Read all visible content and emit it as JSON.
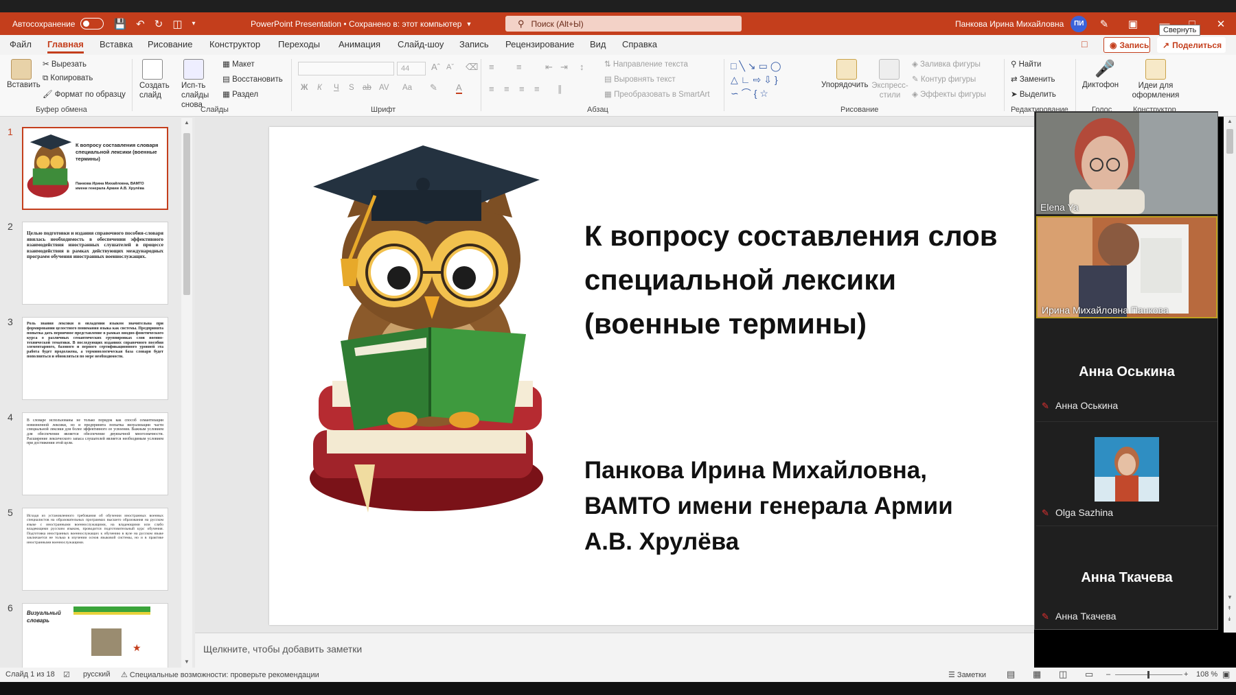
{
  "titlebar": {
    "autosave_label": "Автосохранение",
    "doc_title": "PowerPoint Presentation • Сохранено в: этот компьютер",
    "search_placeholder": "Поиск (Alt+Ы)",
    "user_name": "Панкова Ирина Михайловна",
    "user_initials": "ПИ",
    "tooltip": "Свернуть"
  },
  "tabs": [
    "Файл",
    "Главная",
    "Вставка",
    "Рисование",
    "Конструктор",
    "Переходы",
    "Анимация",
    "Слайд-шоу",
    "Запись",
    "Рецензирование",
    "Вид",
    "Справка"
  ],
  "tab_actions": {
    "record": "Запись",
    "share": "Поделиться"
  },
  "ribbon": {
    "clipboard": {
      "paste": "Вставить",
      "cut": "Вырезать",
      "copy": "Копировать",
      "format_painter": "Формат по образцу",
      "group": "Буфер обмена"
    },
    "slides": {
      "new_slide": "Создать слайд",
      "reuse": "Исп-ть слайды снова",
      "layout": "Макет",
      "reset": "Восстановить",
      "section": "Раздел",
      "group": "Слайды"
    },
    "font": {
      "size": "44",
      "group": "Шрифт"
    },
    "paragraph": {
      "text_direction": "Направление текста",
      "align_text": "Выровнять текст",
      "smartart": "Преобразовать в SmartArt",
      "group": "Абзац"
    },
    "drawing": {
      "arrange": "Упорядочить",
      "quick_styles": "Экспресс-стили",
      "fill": "Заливка фигуры",
      "outline": "Контур фигуры",
      "effects": "Эффекты фигуры",
      "group": "Рисование"
    },
    "editing": {
      "find": "Найти",
      "replace": "Заменить",
      "select": "Выделить",
      "group": "Редактирование"
    },
    "voice": {
      "dictate": "Диктофон",
      "group": "Голос"
    },
    "designer": {
      "ideas": "Идеи для оформления",
      "group": "Конструктор"
    }
  },
  "thumbnails": [
    {
      "num": "1",
      "title": "К вопросу составления словаря специальной лексики (военные термины)",
      "author": "Панкова Ирина Михайловна, ВАМТО имени генерала Армии А.В. Хрулёва"
    },
    {
      "num": "2",
      "text": "Целью подготовки и издания справочного пособия-словаря явилась необходимость в обеспечении эффективного взаимодействия иностранных слушателей в процессе взаимодействия в рамках действующих международных программ обучения иностранных военнослужащих."
    },
    {
      "num": "3",
      "text": "Роль знания лексики в овладении языком значительна при формировании целостного понимания языка как системы. Предпринята попытка дать первичное представление в рамках вводно-фонетического курса о различных семантических группировках слов военно-технической тематики. В последующих изданиях справочного пособия элементарного, базового и первого сертификационного уровней эта работа будет продолжена, а терминологическая база словаря будет пополняться и обновляться по мере необходимости."
    },
    {
      "num": "4",
      "text": "В словаре использованы не только порядок как способ семантизации новизненной лексики, но и предпринята попытка визуализации части специальной лексики для более эффективного ее усвоения. Важным условием для обеспечения является обеспечение двуязычной многозначности. Расширение лексического запаса слушателей является необходимым условием при достижении этой цели."
    },
    {
      "num": "5",
      "text": "Исходя из установленного требования об обучении иностранных военных специалистов на образовательных программах высшего образования на русском языке с иностранными военнослужащими, на владеющими или слабо владеющими русским языком, проводится подготовительный курс обучения. Подготовка иностранных военнослужащих к обучению в вузе на русском языке заключается не только в изучении основ языковой системы, но и в практике иностранными военнослужащими."
    },
    {
      "num": "6",
      "label": "Визуальный словарь"
    }
  ],
  "slide": {
    "title_lines": [
      "К вопросу составления слов",
      "специальной лексики",
      "(военные термины)"
    ],
    "author_lines": [
      "Панкова Ирина Михайловна,",
      "ВАМТО имени генерала Армии",
      "А.В. Хрулёва"
    ]
  },
  "notes_placeholder": "Щелкните, чтобы добавить заметки",
  "meeting": {
    "participants": [
      {
        "name": "Elena Ya",
        "type": "video"
      },
      {
        "name": "Ирина Михайловна Панкова",
        "type": "video"
      },
      {
        "name": "Анна Оськина",
        "type": "name"
      },
      {
        "name": "Olga Sazhina",
        "type": "avatar"
      },
      {
        "name": "Анна Ткачева",
        "type": "name"
      }
    ]
  },
  "status": {
    "slide_counter": "Слайд 1 из 18",
    "language": "русский",
    "accessibility": "Специальные возможности: проверьте рекомендации",
    "notes": "Заметки",
    "zoom": "108 %"
  },
  "colors": {
    "accent": "#c43e1c",
    "meeting_bg": "#1f1f1f",
    "mic_muted": "#e03030"
  }
}
